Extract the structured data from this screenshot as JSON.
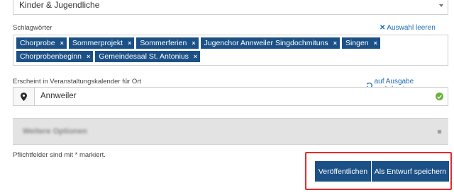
{
  "category_field": {
    "value": "Kinder & Jugendliche"
  },
  "keywords": {
    "label": "Schlagwörter",
    "clear_link": "Auswahl leeren",
    "tags": [
      "Chorprobe",
      "Sommerprojekt",
      "Sommerferien",
      "Jugenchor Annweiler Singdochmituns",
      "Singen",
      "Chorprobenbeginn",
      "Gemeindesaal St. Antonius"
    ],
    "remove_glyph": "×"
  },
  "location": {
    "label": "Erscheint in Veranstaltungskalender für Ort",
    "reset_link": "auf Ausgabe zurücksetzen",
    "value": "Annweiler"
  },
  "collapsed_panel": {
    "title": "Weitere Optionen"
  },
  "footer": {
    "required_note": "Pflichtfelder sind mit * markiert.",
    "publish_label": "Veröffentlichen",
    "draft_label": "Als Entwurf speichern"
  },
  "colors": {
    "brand": "#1c5187",
    "link": "#1f6bb3",
    "success": "#6ab23d",
    "highlight": "#e32b2b"
  },
  "icons": {
    "chevron": "chevron-down-icon",
    "clear": "close-icon",
    "reset": "undo-icon",
    "location": "map-pin-icon",
    "valid": "check-circle-icon"
  }
}
